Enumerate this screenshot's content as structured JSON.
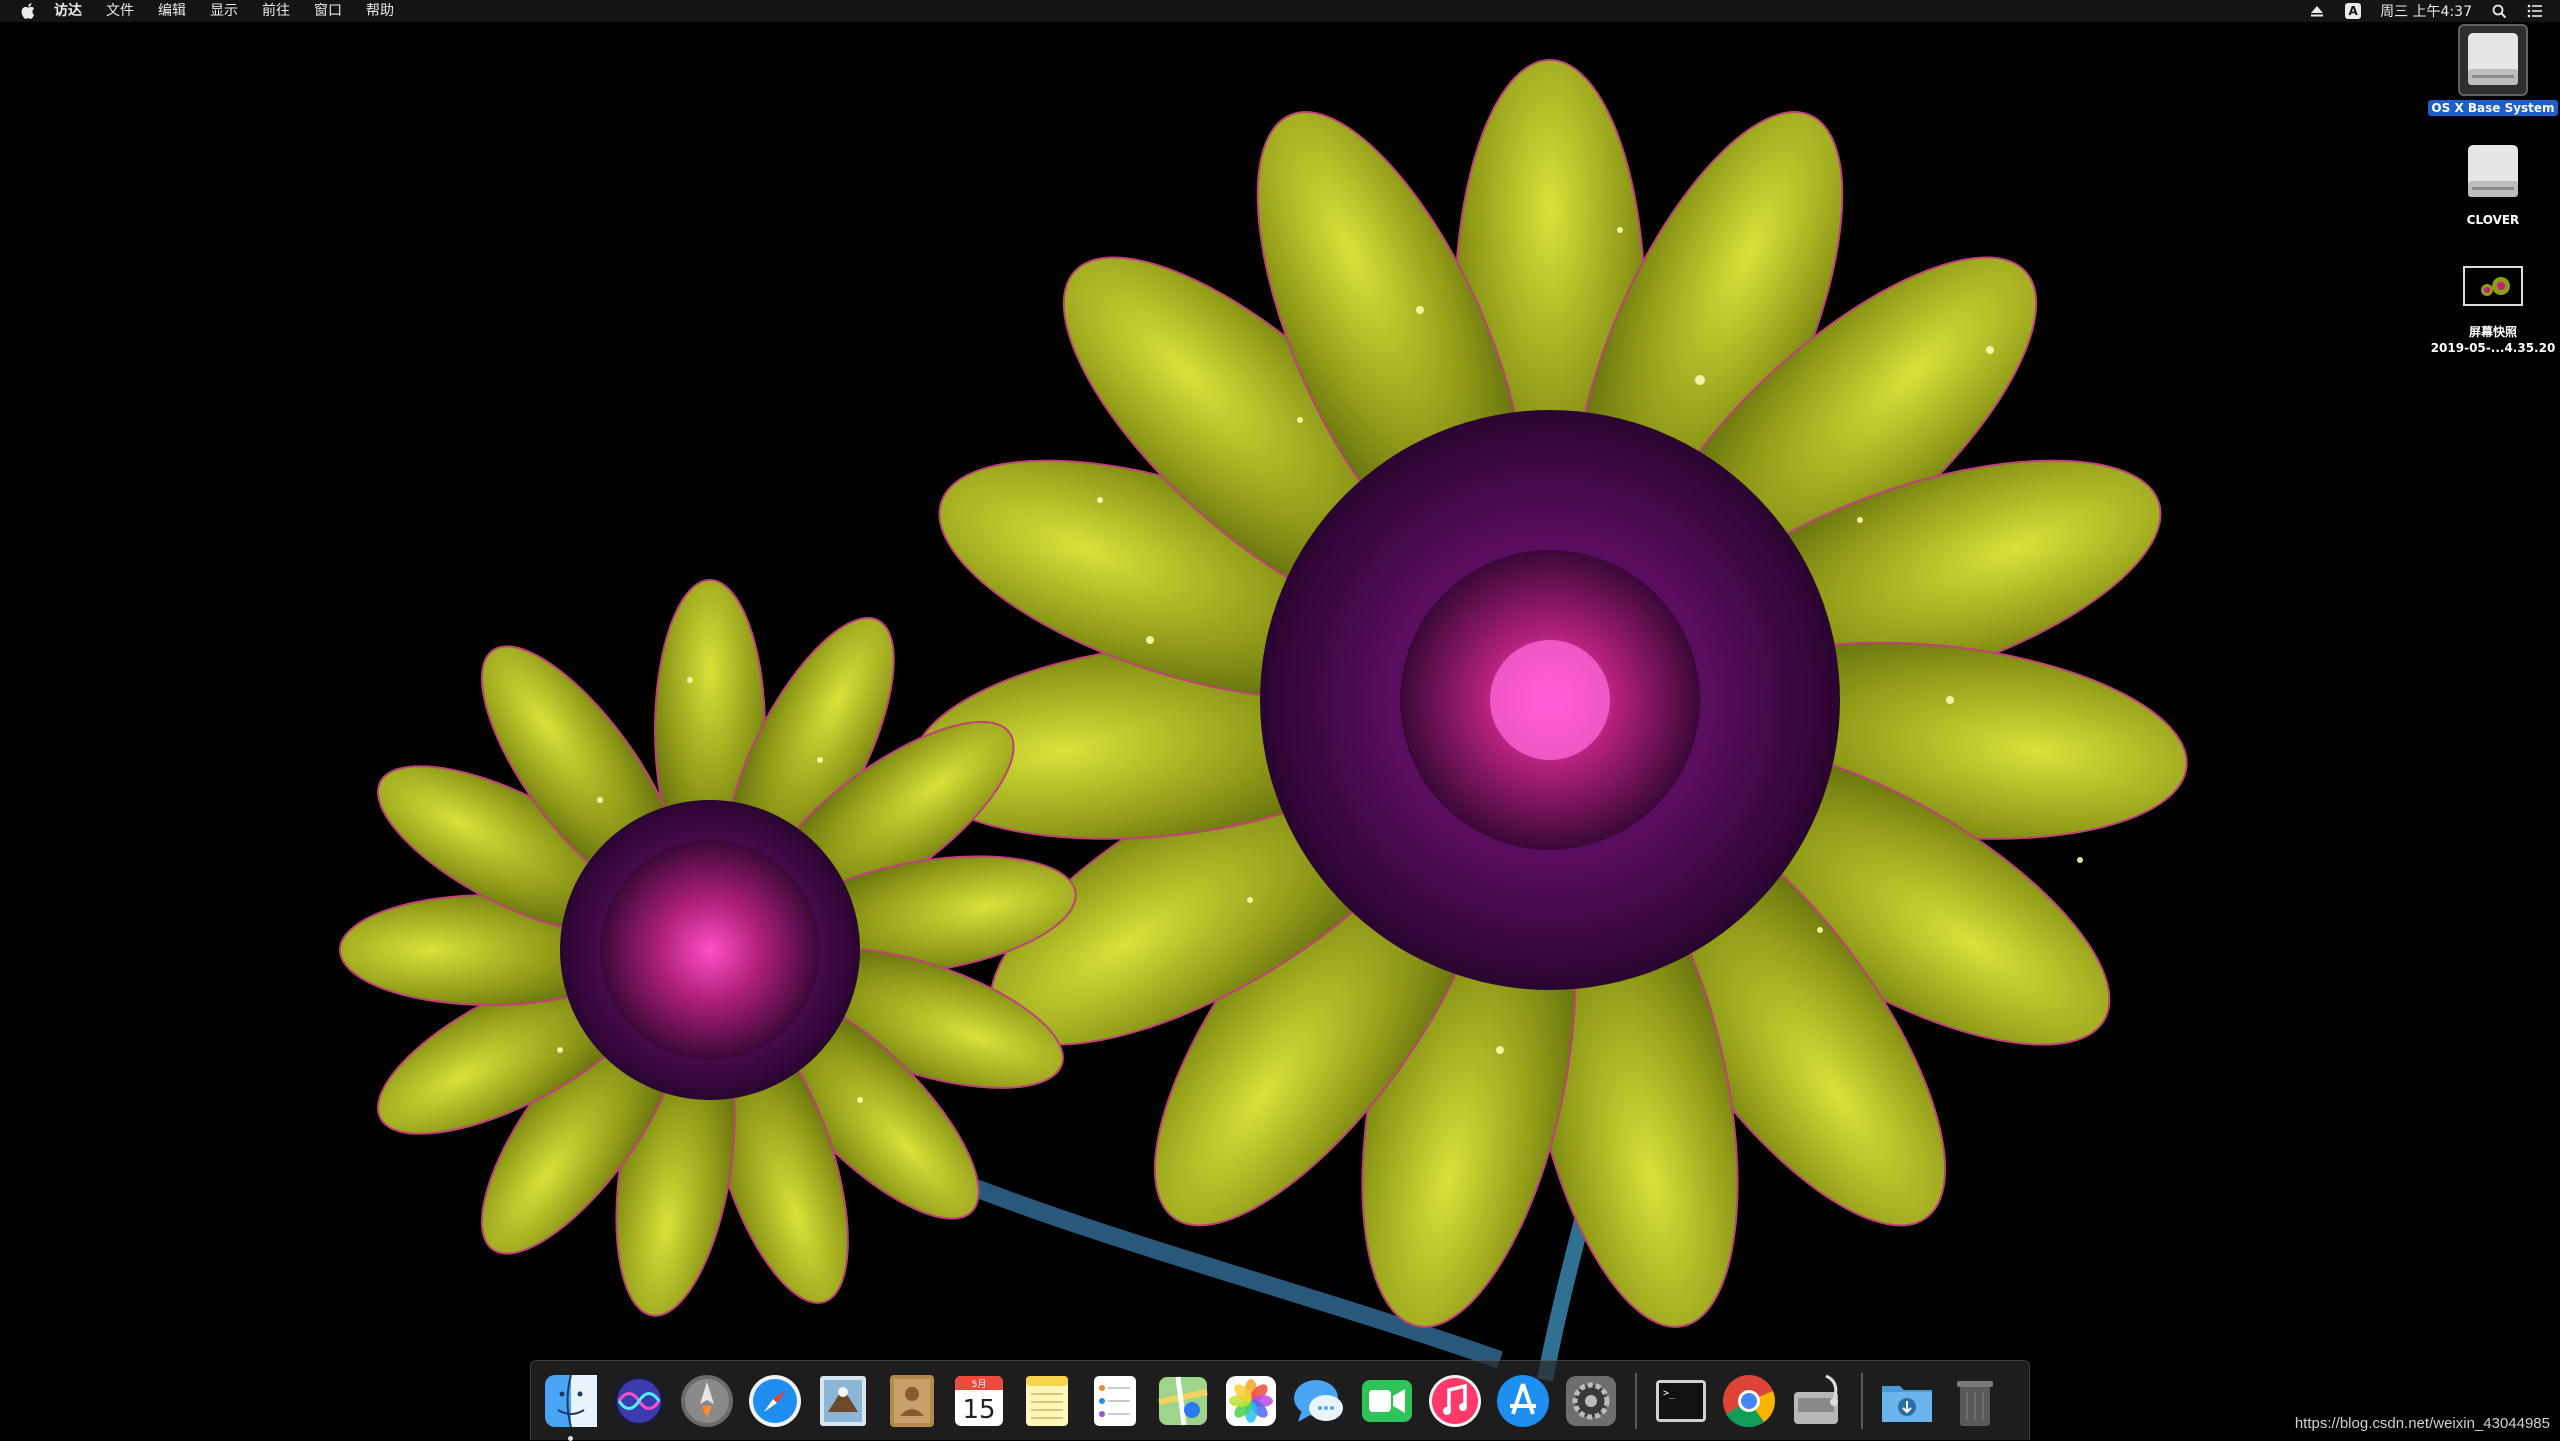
{
  "menubar": {
    "app_name": "访达",
    "menus": [
      "文件",
      "编辑",
      "显示",
      "前往",
      "窗口",
      "帮助"
    ],
    "input_badge": "A",
    "clock": "周三 上午4:37"
  },
  "desktop": {
    "icons": [
      {
        "label": "OS X Base System",
        "selected": true,
        "kind": "drive"
      },
      {
        "label": "CLOVER",
        "selected": false,
        "kind": "drive"
      },
      {
        "label": "屏幕快照",
        "label_line2": "2019-05-...4.35.20",
        "selected": false,
        "kind": "screenshot"
      }
    ]
  },
  "dock": {
    "calendar_month": "5月",
    "calendar_day": "15",
    "items": [
      "finder-icon",
      "siri-icon",
      "launchpad-icon",
      "safari-icon",
      "mail-icon",
      "contacts-icon",
      "calendar-icon",
      "notes-icon",
      "reminders-icon",
      "maps-icon",
      "photos-icon",
      "messages-icon",
      "facetime-icon",
      "itunes-icon",
      "app-store-icon",
      "system-preferences-icon",
      "terminal-icon",
      "chrome-icon",
      "disk-utility-icon",
      "downloads-folder-icon",
      "trash-icon"
    ]
  },
  "watermark": "https://blog.csdn.net/weixin_43044985"
}
